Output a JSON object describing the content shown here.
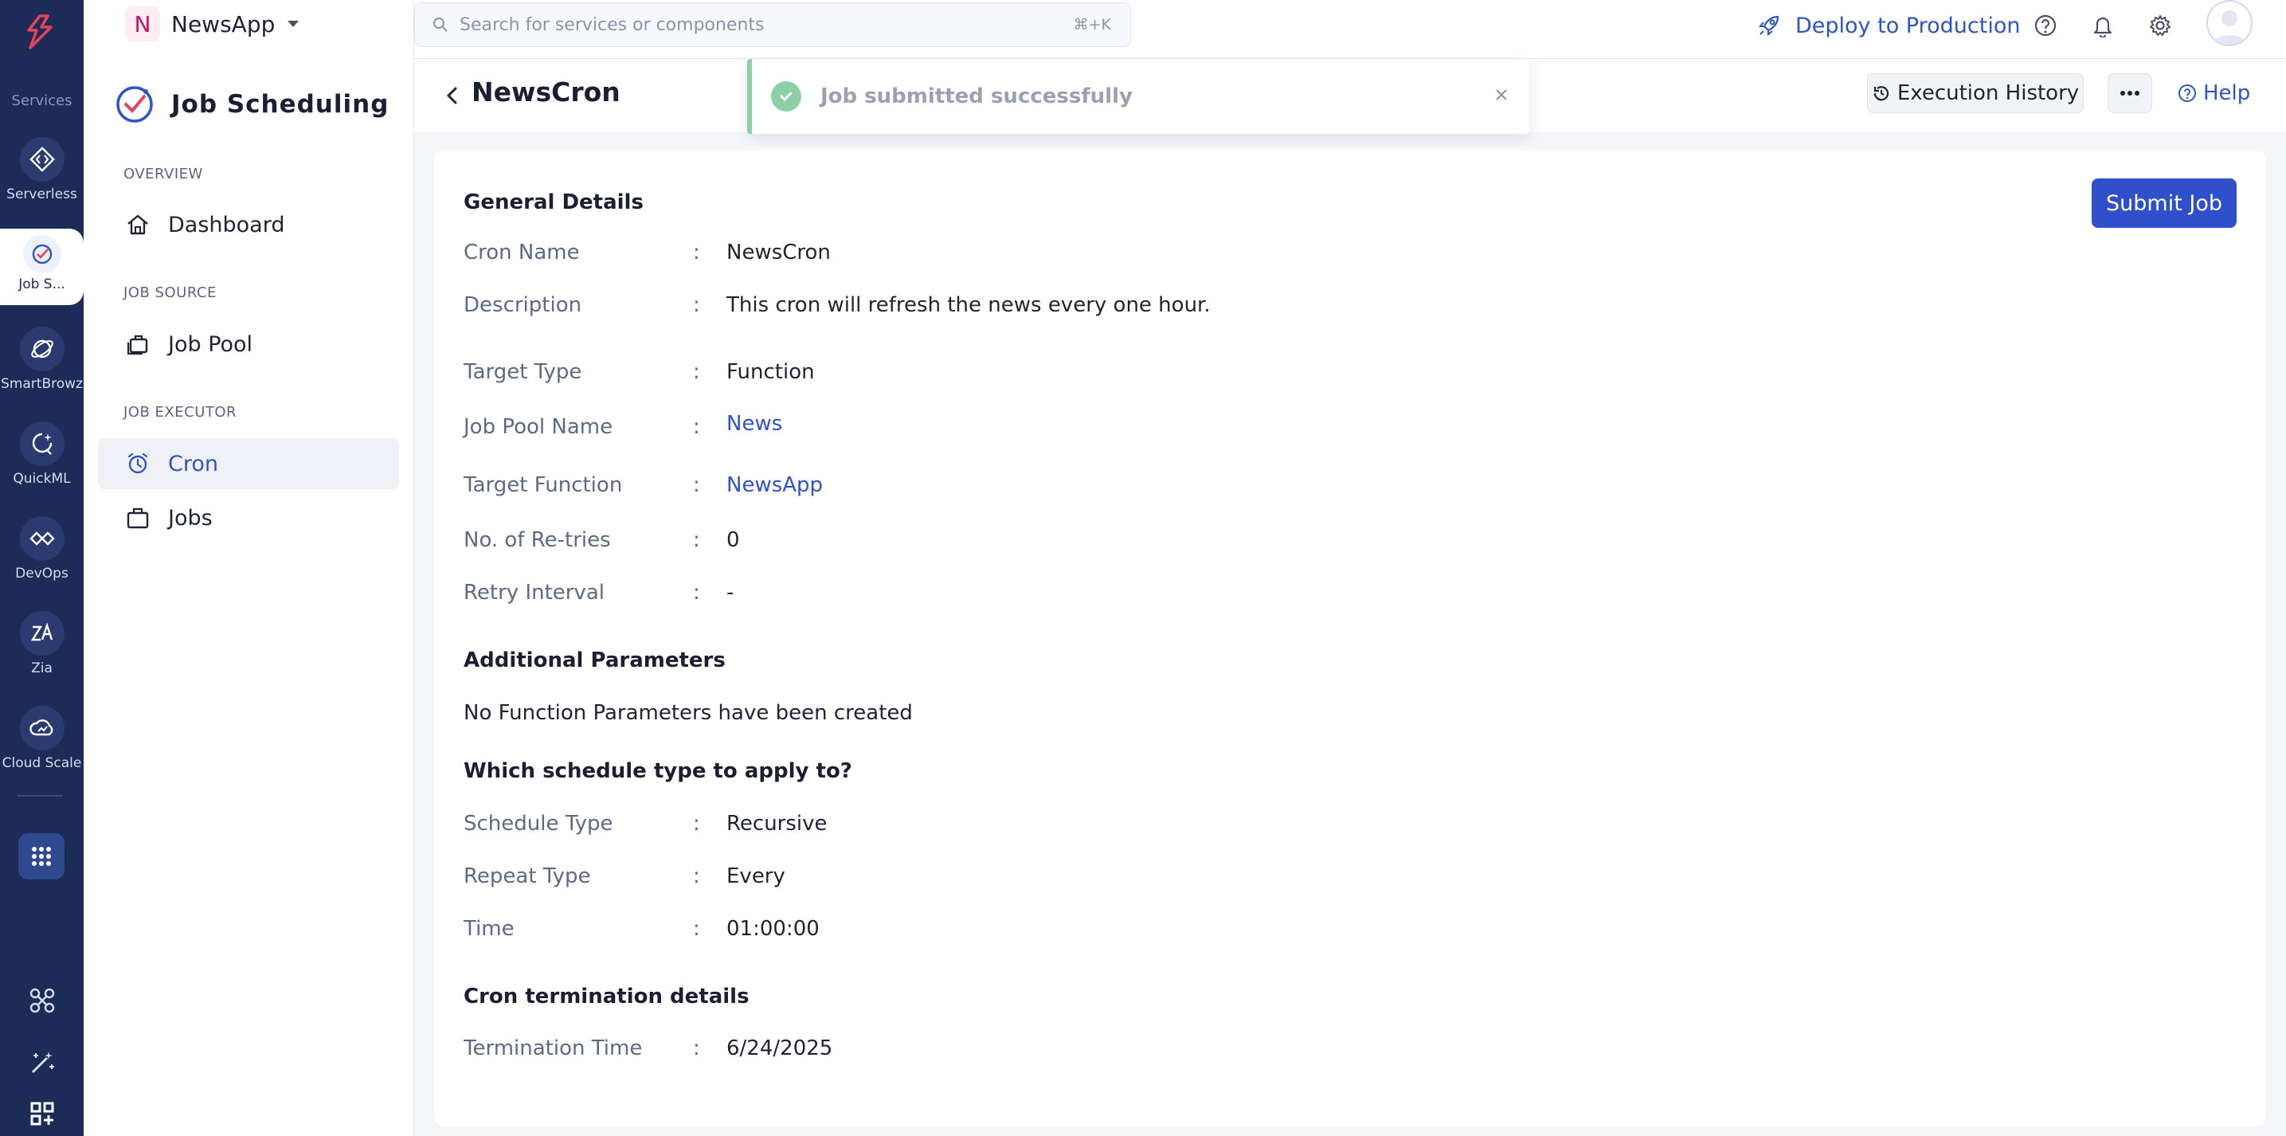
{
  "rail": {
    "section_label": "Services",
    "items": [
      {
        "label": "Serverless"
      },
      {
        "label": "Job S..."
      },
      {
        "label": "SmartBrowz"
      },
      {
        "label": "QuickML"
      },
      {
        "label": "DevOps"
      },
      {
        "label": "Zia"
      },
      {
        "label": "Cloud Scale"
      }
    ]
  },
  "app": {
    "badge": "N",
    "name": "NewsApp"
  },
  "nav": {
    "title": "Job Scheduling",
    "groups": {
      "overview": "OVERVIEW",
      "job_source": "JOB SOURCE",
      "job_executor": "JOB EXECUTOR"
    },
    "items": {
      "dashboard": "Dashboard",
      "job_pool": "Job Pool",
      "cron": "Cron",
      "jobs": "Jobs"
    }
  },
  "topbar": {
    "search_placeholder": "Search for services or components",
    "search_shortcut": "⌘+K",
    "deploy_label": "Deploy to Production"
  },
  "page": {
    "title": "NewsCron",
    "history_button": "Execution History",
    "help_label": "Help",
    "submit_button": "Submit Job"
  },
  "toast": {
    "message": "Job submitted successfully"
  },
  "general": {
    "heading": "General Details",
    "rows": [
      {
        "label": "Cron Name",
        "value": "NewsCron"
      },
      {
        "label": "Description",
        "value": "This cron will refresh the news every one hour."
      },
      {
        "label": "Target Type",
        "value": "Function"
      },
      {
        "label": "Job Pool Name",
        "value": "News"
      },
      {
        "label": "Target Function",
        "value": "NewsApp"
      },
      {
        "label": "No. of Re-tries",
        "value": "0"
      },
      {
        "label": "Retry Interval",
        "value": "-"
      }
    ]
  },
  "params": {
    "heading": "Additional Parameters",
    "empty_text": "No Function Parameters have been created"
  },
  "schedule": {
    "heading": "Which schedule type to apply to?",
    "rows": [
      {
        "label": "Schedule Type",
        "value": "Recursive"
      },
      {
        "label": "Repeat Type",
        "value": "Every"
      },
      {
        "label": "Time",
        "value": "01:00:00"
      }
    ]
  },
  "termination": {
    "heading": "Cron termination details",
    "rows": [
      {
        "label": "Termination Time",
        "value": "6/24/2025"
      }
    ]
  },
  "separator": ":",
  "colors": {
    "rail": "#1d2b57",
    "accent": "#2f53c8",
    "primary_button": "#2f4fcb",
    "success": "#8bd1a4"
  }
}
